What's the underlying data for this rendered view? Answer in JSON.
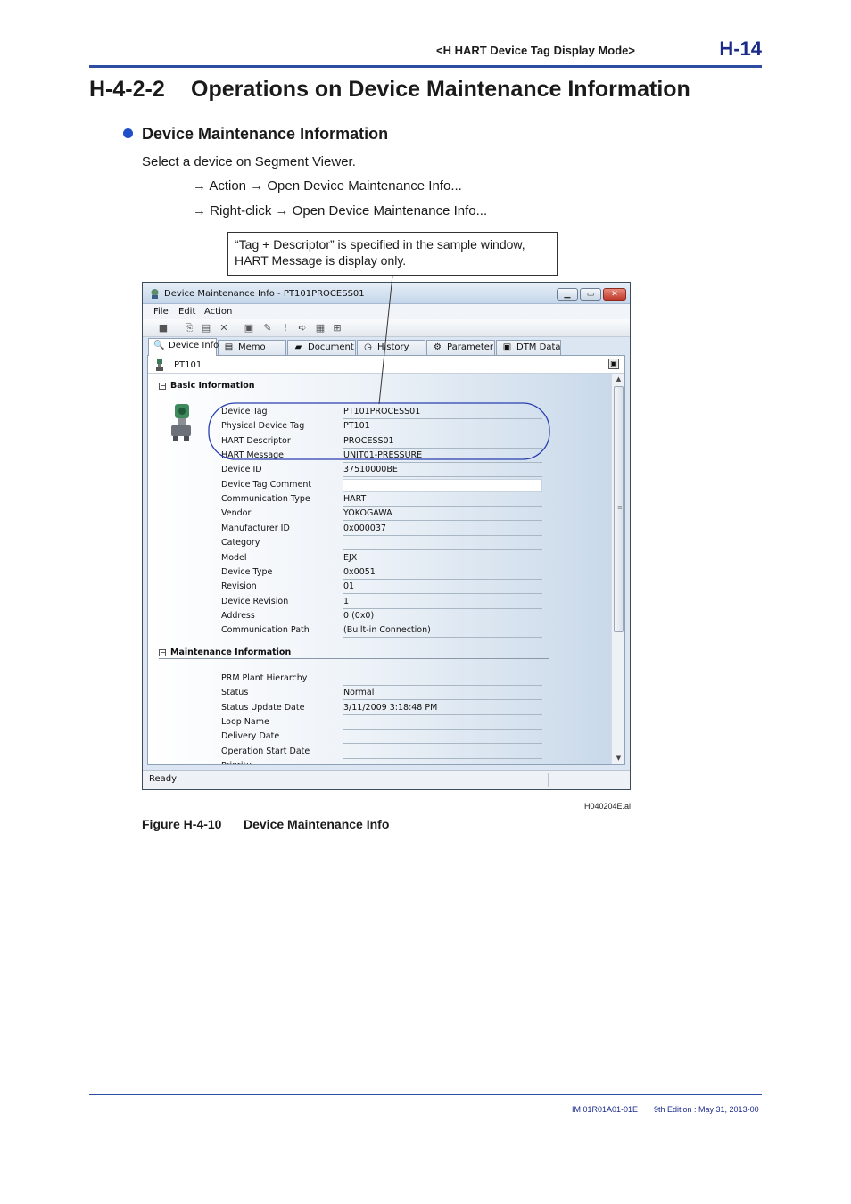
{
  "header": {
    "section": "<H  HART Device Tag Display Mode>",
    "page": "H-14"
  },
  "section": {
    "number": "H-4-2-2",
    "title": "Operations on Device Maintenance Information"
  },
  "subsection": {
    "title": "Device Maintenance Information",
    "intro": "Select a device on Segment Viewer.",
    "steps": [
      "→ Action → Open Device Maintenance Info...",
      "→ Right-click → Open Device Maintenance Info..."
    ]
  },
  "callout": {
    "line1": "“Tag + Descriptor” is specified in the sample window,",
    "line2": "HART Message is display only."
  },
  "window": {
    "title": "Device Maintenance Info - PT101PROCESS01",
    "menu": [
      "File",
      "Edit",
      "Action"
    ],
    "tabs": [
      "Device Info",
      "Memo",
      "Document",
      "History",
      "Parameter",
      "DTM Data"
    ],
    "device_name": "PT101",
    "basic_title": "Basic Information",
    "basic_rows": [
      {
        "label": "Device Tag",
        "value": "PT101PROCESS01"
      },
      {
        "label": "Physical Device Tag",
        "value": "PT101"
      },
      {
        "label": "HART Descriptor",
        "value": "PROCESS01"
      },
      {
        "label": "HART Message",
        "value": "UNIT01-PRESSURE"
      },
      {
        "label": "Device ID",
        "value": "37510000BE"
      },
      {
        "label": "Device Tag Comment",
        "value": ""
      },
      {
        "label": "Communication Type",
        "value": "HART"
      },
      {
        "label": "Vendor",
        "value": "YOKOGAWA"
      },
      {
        "label": "Manufacturer ID",
        "value": "0x000037"
      },
      {
        "label": "Category",
        "value": ""
      },
      {
        "label": "Model",
        "value": "EJX"
      },
      {
        "label": "Device Type",
        "value": "0x0051"
      },
      {
        "label": "Revision",
        "value": "01"
      },
      {
        "label": "Device Revision",
        "value": "1"
      },
      {
        "label": "Address",
        "value": "0 (0x0)"
      },
      {
        "label": "Communication Path",
        "value": "(Built-in Connection)"
      }
    ],
    "maint_title": "Maintenance Information",
    "maint_rows": [
      {
        "label": "PRM Plant Hierarchy",
        "value": ""
      },
      {
        "label": "Status",
        "value": "Normal"
      },
      {
        "label": "Status Update Date",
        "value": "3/11/2009 3:18:48 PM"
      },
      {
        "label": "Loop Name",
        "value": ""
      },
      {
        "label": "Delivery Date",
        "value": ""
      },
      {
        "label": "Operation Start Date",
        "value": ""
      },
      {
        "label": "Priority",
        "value": ""
      }
    ],
    "status": "Ready",
    "highlight_color": "#2a3fb0"
  },
  "figure": {
    "file": "H040204E.ai",
    "number": "Figure H-4-10",
    "caption": "Device Maintenance Info"
  },
  "footer": {
    "doc": "IM 01R01A01-01E",
    "edition": "9th Edition : May 31, 2013-00"
  }
}
